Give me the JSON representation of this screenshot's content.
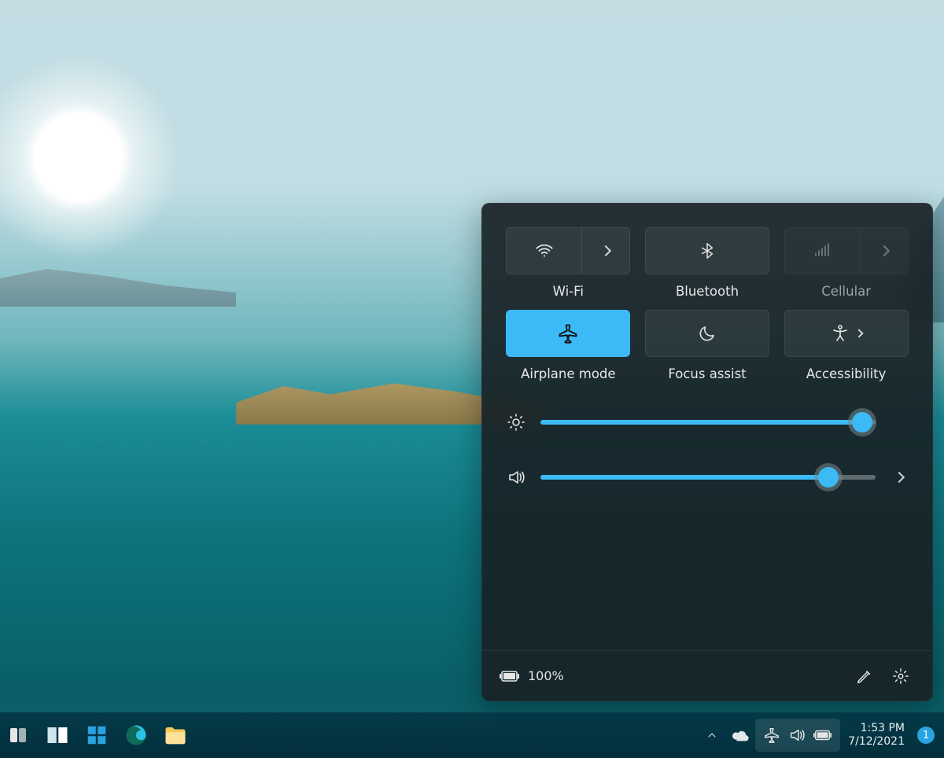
{
  "quick_settings": {
    "tiles": {
      "wifi": {
        "label": "Wi-Fi",
        "active": false,
        "disabled": false
      },
      "bluetooth": {
        "label": "Bluetooth",
        "active": false,
        "disabled": false
      },
      "cellular": {
        "label": "Cellular",
        "active": false,
        "disabled": true
      },
      "airplane": {
        "label": "Airplane mode",
        "active": true,
        "disabled": false
      },
      "focus": {
        "label": "Focus assist",
        "active": false,
        "disabled": false
      },
      "a11y": {
        "label": "Accessibility",
        "active": false,
        "disabled": false
      }
    },
    "brightness_percent": 96,
    "volume_percent": 86,
    "battery_text": "100%"
  },
  "taskbar": {
    "time": "1:53 PM",
    "date": "7/12/2021",
    "notification_count": "1"
  },
  "colors": {
    "accent": "#3cbaf6"
  }
}
